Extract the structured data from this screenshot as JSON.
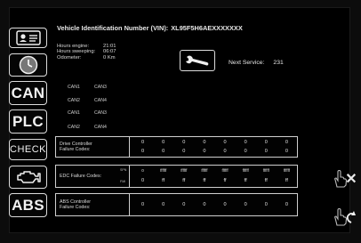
{
  "vin": {
    "label": "Vehicle Identification Number (VIN):",
    "value": "XL95F5H6AEXXXXXXX"
  },
  "side_buttons": {
    "can": "CAN",
    "plc": "PLC",
    "check": "CHECK",
    "abs": "ABS"
  },
  "info": {
    "hours_engine_label": "Hours engine:",
    "hours_engine": "21:01",
    "hours_sweeping_label": "Hours sweeping:",
    "hours_sweeping": "06:07",
    "odometer_label": "Odometer:",
    "odometer": "0 Km"
  },
  "service": {
    "label": "Next Service:",
    "value": "231"
  },
  "can_labels": {
    "can1": "CAN1",
    "can2": "CAN2",
    "can3": "CAN3",
    "can4": "CAN4"
  },
  "plc_labels": {
    "can1": "CAN1",
    "can2": "CAN2",
    "can3": "CAN3",
    "can4": "CAN4"
  },
  "drive": {
    "label_1": "Drive Controller",
    "label_2": "Failure Codes:",
    "row1": [
      "0",
      "0",
      "0",
      "0",
      "0",
      "0",
      "0",
      "0"
    ],
    "row2": [
      "0",
      "0",
      "0",
      "0",
      "0",
      "0",
      "0",
      "0"
    ]
  },
  "edc": {
    "label": "EDC Failure Codes:",
    "spn_label": "SPN",
    "fmi_label": "FMI",
    "spn": [
      "0",
      "ffffff",
      "ffffff",
      "ffffff",
      "ffffff",
      "ffffff",
      "ffffff",
      "ffffff"
    ],
    "fmi": [
      "0",
      "ff",
      "ff",
      "ff",
      "ff",
      "ff",
      "ff",
      "ff"
    ]
  },
  "abs": {
    "label_1": "ABS Controller",
    "label_2": "Failure Codes:",
    "values": [
      "0",
      "0",
      "0",
      "0",
      "0",
      "0",
      "0",
      "0"
    ]
  },
  "icons": [
    "id-card-icon",
    "clock-icon",
    "engine-warning-icon",
    "wrench-icon",
    "hand-close-icon",
    "hand-back-icon"
  ]
}
